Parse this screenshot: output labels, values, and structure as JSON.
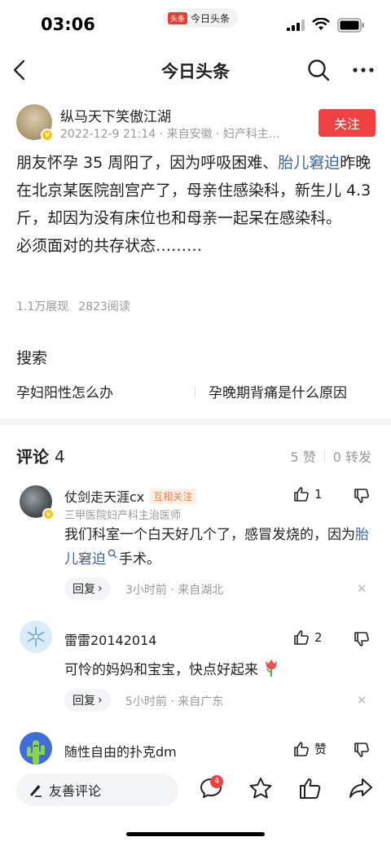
{
  "status_bar": {
    "time": "03:06",
    "app_pill": "今日头条",
    "app_pill_logo": "头条"
  },
  "nav": {
    "title": "今日头条"
  },
  "post": {
    "author": "纵马天下笑傲江湖",
    "meta": "2022-12-9 21:14 · 来自安徽 · 妇产科主...",
    "follow_label": "关注",
    "body_line1_a": "朋友怀孕 35 周阳了，因为呼吸困难、",
    "body_line1_link": "胎儿窘迫",
    "body_rest": "昨晚在北京某医院剖宫产了，母亲住感染科，新生儿 4.3 斤，却因为没有床位也和母亲一起呆在感染科。",
    "body_last": "必须面对的共存状态………",
    "views": "1.1万展现",
    "reads": "2823阅读"
  },
  "search": {
    "title": "搜索",
    "suggestions": [
      "孕妇阳性怎么办",
      "孕晚期背痛是什么原因"
    ]
  },
  "comments_header": {
    "title": "评论",
    "count": "4",
    "likes": "5 赞",
    "shares": "0 转发"
  },
  "comments": [
    {
      "name": "仗剑走天涯cx",
      "tag": "互相关注",
      "subtitle": "三甲医院妇产科主治医师",
      "text_a": "我们科室一个白天好几个了，感冒发烧的，因为",
      "text_link": "胎儿窘迫",
      "text_b": "手术。",
      "likes": "1",
      "reply": "回复",
      "time": "3小时前 · 来自湖北"
    },
    {
      "name": "雷雷20142014",
      "text_a": "可怜的妈妈和宝宝，快点好起来",
      "likes": "2",
      "reply": "回复",
      "time": "5小时前 · 来自广东"
    },
    {
      "name": "随性自由的扑克dm",
      "likes": "赞"
    }
  ],
  "bottom_bar": {
    "input_placeholder": "友善评论",
    "comment_badge": "4"
  },
  "colors": {
    "accent_red": "#f04142",
    "link_blue": "#406599",
    "muted": "#999999"
  }
}
